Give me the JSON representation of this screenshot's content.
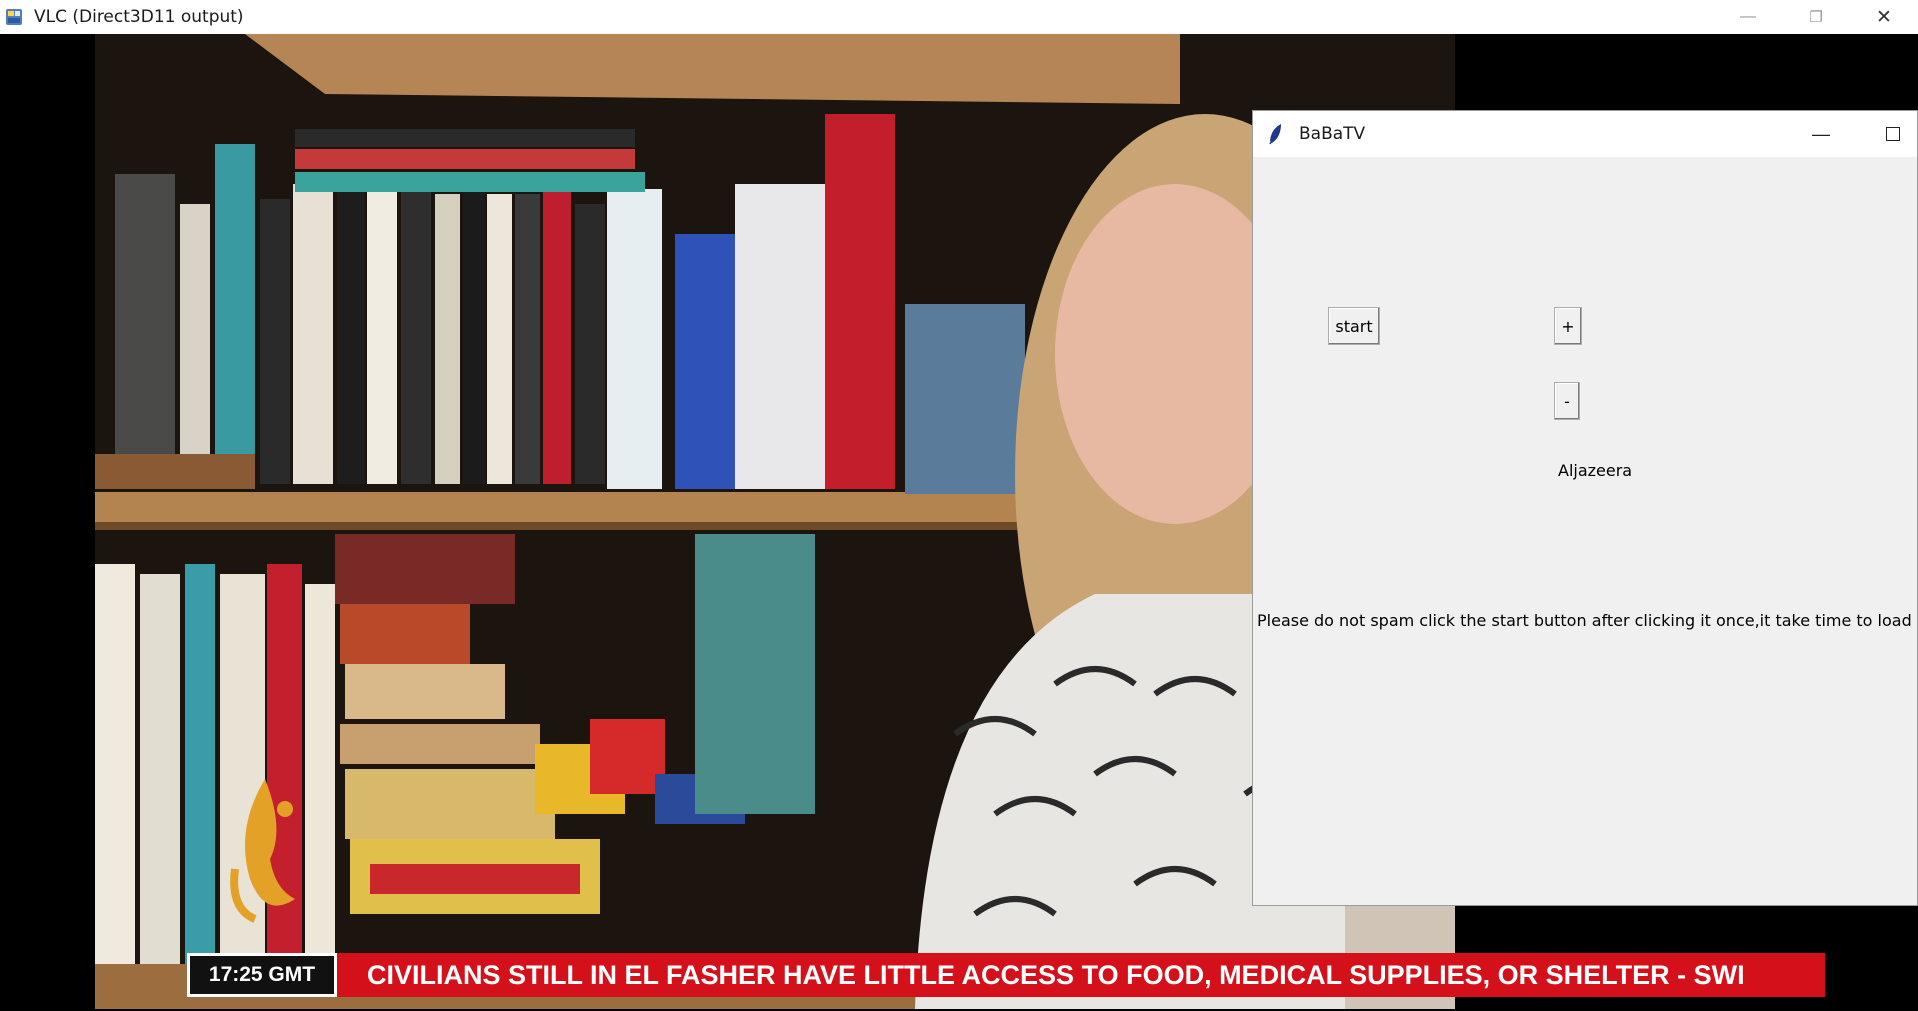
{
  "vlc": {
    "title": "VLC (Direct3D11 output)",
    "controls": {
      "minimize": "—",
      "restore": "❐",
      "close": "✕"
    }
  },
  "video": {
    "clock": "17:25  GMT",
    "ticker": "CIVILIANS STILL IN EL FASHER HAVE LITTLE ACCESS TO FOOD, MEDICAL SUPPLIES, OR SHELTER   -   SWI",
    "ticker_color": "#d4101a"
  },
  "babatv": {
    "title": "BaBaTV",
    "controls": {
      "minimize": "—"
    },
    "start_label": "start",
    "plus_label": "+",
    "minus_label": "-",
    "channel": "Aljazeera",
    "notice": "Please do not spam click the start button after  clicking it once,it take time to load"
  }
}
